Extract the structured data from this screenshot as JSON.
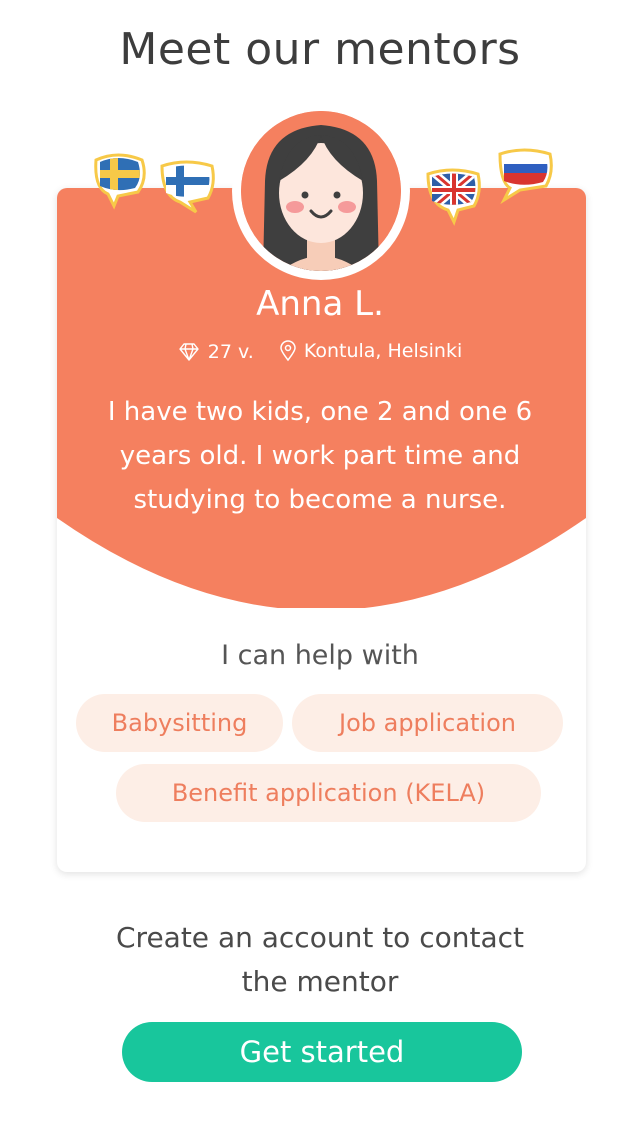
{
  "page": {
    "title": "Meet our mentors"
  },
  "mentor": {
    "name": "Anna L.",
    "age": "27 v.",
    "location": "Kontula, Helsinki",
    "bio_line1": "I have two kids, one 2 and one 6",
    "bio_line2": "years old. I work part time and",
    "bio_line3": "studying to become a nurse.",
    "languages": [
      "swedish-flag",
      "finnish-flag",
      "uk-flag",
      "russian-flag"
    ]
  },
  "help": {
    "title": "I can help with",
    "chips": [
      "Babysitting",
      "Job application",
      "Benefit application (KELA)"
    ]
  },
  "cta": {
    "line1": "Create an account to contact",
    "line2": "the mentor",
    "button_label": "Get started"
  },
  "colors": {
    "accent": "#f5805f",
    "chip_bg": "#fdeee6",
    "chip_text": "#ee7e5e",
    "button": "#18c69c"
  }
}
